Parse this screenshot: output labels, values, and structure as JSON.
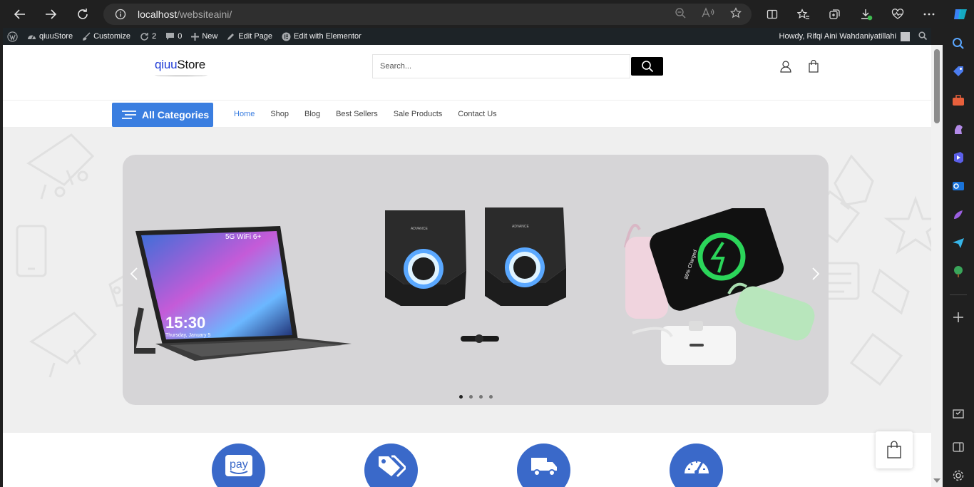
{
  "browser": {
    "url_host": "localhost",
    "url_path": "/websiteaini/"
  },
  "adminbar": {
    "site_name": "qiuuStore",
    "customize": "Customize",
    "updates_count": "2",
    "comments_count": "0",
    "new_label": "New",
    "edit_page": "Edit Page",
    "edit_elementor": "Edit with Elementor",
    "howdy": "Howdy, Rifqi Aini Wahdaniyatillahi"
  },
  "header": {
    "logo_q": "qiuu",
    "logo_s": "Store",
    "search_placeholder": "Search..."
  },
  "nav": {
    "all_categories": "All Categories",
    "items": [
      "Home",
      "Shop",
      "Blog",
      "Best Sellers",
      "Sale Products",
      "Contact Us"
    ]
  },
  "slider": {
    "dots": 4,
    "active_dot": 1,
    "tablet_time": "15:30",
    "tablet_date": "Thursday, January 5",
    "tablet_badge": "5G WiFi 6+",
    "speaker_brand": "ADVANCE",
    "phone_text": "80% Charged"
  },
  "features": {
    "icons": [
      "amazon-pay-icon",
      "tags-icon",
      "truck-icon",
      "speedometer-icon"
    ],
    "pay_text": "pay"
  },
  "colors": {
    "accent": "#3a7ee0",
    "feature_circle": "#3a69c9",
    "adminbar": "#1d2327"
  }
}
